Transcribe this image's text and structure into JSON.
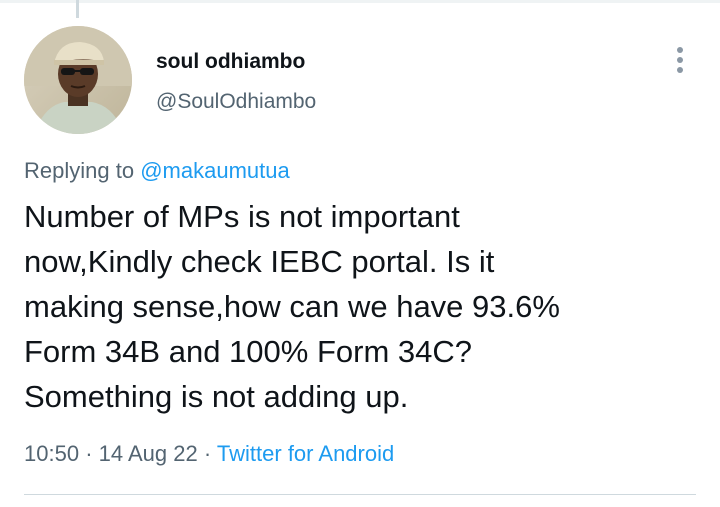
{
  "author": {
    "display_name": "soul odhiambo",
    "handle": "@SoulOdhiambo"
  },
  "reply": {
    "prefix": "Replying to",
    "mention": "@makaumutua"
  },
  "tweet": {
    "lines": [
      "Number of MPs is not important",
      "now,Kindly check IEBC portal. Is it",
      "making sense,how can we have 93.6%",
      "Form 34B and 100% Form 34C?",
      "Something is not adding up."
    ]
  },
  "meta": {
    "time": "10:50",
    "separator_1": "·",
    "date": "14 Aug 22",
    "separator_2": "·",
    "source": "Twitter for Android"
  },
  "icons": {
    "more": "more-vertical-icon",
    "avatar": "avatar"
  },
  "colors": {
    "link": "#1d9bf0",
    "secondary_text": "#536471",
    "primary_text": "#0f1419"
  }
}
